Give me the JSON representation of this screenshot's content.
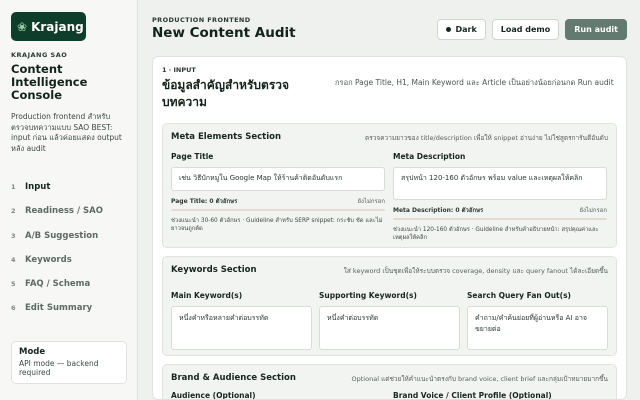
{
  "sidebar": {
    "logo_text": "Krajang",
    "brand_tag": "KRAJANG SAO",
    "app_title": "Content Intelligence Console",
    "description": "Production frontend สำหรับตรวจบทความแบบ SAO BEST: input ก่อน แล้วค่อยแสดง output หลัง audit",
    "nav": [
      {
        "num": "1",
        "label": "Input",
        "active": true
      },
      {
        "num": "2",
        "label": "Readiness / SAO",
        "active": false
      },
      {
        "num": "3",
        "label": "A/B Suggestion",
        "active": false
      },
      {
        "num": "4",
        "label": "Keywords",
        "active": false
      },
      {
        "num": "5",
        "label": "FAQ / Schema",
        "active": false
      },
      {
        "num": "6",
        "label": "Edit Summary",
        "active": false
      }
    ],
    "mode": {
      "title": "Mode",
      "value": "API mode — backend required"
    }
  },
  "header": {
    "eyebrow": "PRODUCTION FRONTEND",
    "title": "New Content Audit",
    "dark_label": "Dark",
    "demo_label": "Load demo",
    "run_label": "Run audit"
  },
  "step": {
    "label": "1 · INPUT",
    "title": "ข้อมูลสำคัญสำหรับตรวจบทความ",
    "description": "กรอก Page Title, H1, Main Keyword และ Article เป็นอย่างน้อยก่อนกด Run audit"
  },
  "meta_section": {
    "title": "Meta Elements Section",
    "description": "ตรวจความยาวของ title/description เพื่อให้ snippet อ่านง่าย ไม่ใช่สูตรการันตีอันดับ",
    "page_title": {
      "label": "Page Title",
      "value": "เช่น วิธีบักหมูใน Google Map ให้ร้านค้าติดอันดับแรก",
      "counter": "Page Title: 0 ตัวอักษร",
      "status": "ยังไม่กรอก",
      "fill": 0,
      "hint": "ช่วงแนะนำ 30-60 ตัวอักษร · Guideline สำหรับ SERP snippet: กระชับ ชัด และไม่ยาวจนถูกตัด"
    },
    "meta_description": {
      "label": "Meta Description",
      "value": "สรุปหน้า 120-160 ตัวอักษร พร้อม value และเหตุผลให้คลิก",
      "counter": "Meta Description: 0 ตัวอักษร",
      "status": "ยังไม่กรอก",
      "fill": 0,
      "hint": "ช่วงแนะนำ 120-160 ตัวอักษร · Guideline สำหรับคำอธิบายหน้า: สรุปคุณค่าและเหตุผลให้คลิก"
    }
  },
  "keywords_section": {
    "title": "Keywords Section",
    "description": "ใส่ keyword เป็นชุดเพื่อให้ระบบตรวจ coverage, density และ query fanout ได้ละเอียดขึ้น",
    "main": {
      "label": "Main Keyword(s)",
      "placeholder": "หนึ่งคำหรือหลายคำต่อบรรทัด"
    },
    "supporting": {
      "label": "Supporting Keyword(s)",
      "placeholder": "หนึ่งคำต่อบรรทัด"
    },
    "fanout": {
      "label": "Search Query Fan Out(s)",
      "placeholder": "คำถาม/คำค้นย่อยที่ผู้อ่านหรือ AI อาจขยายต่อ"
    }
  },
  "brand_section": {
    "title": "Brand & Audience Section",
    "description": "Optional แต่ช่วยให้คำแนะนำตรงกับ brand voice, client brief และกลุ่มเป้าหมายมากขึ้น",
    "audience_label": "Audience (Optional)",
    "voice_label": "Brand Voice / Client Profile (Optional)"
  }
}
